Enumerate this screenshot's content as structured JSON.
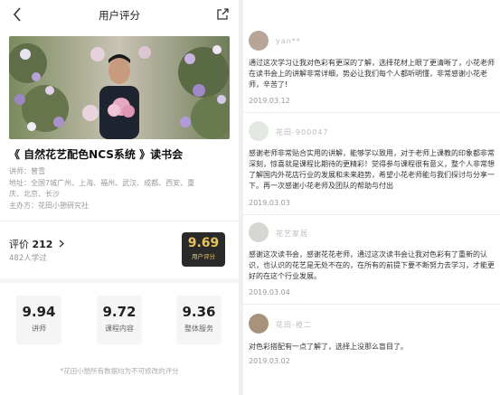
{
  "header": {
    "title": "用户评分"
  },
  "course": {
    "title": "《 自然花艺配色NCS系统 》读书会",
    "lecturer_label": "讲师：",
    "lecturer": "曾雪",
    "address_label": "地址：",
    "address_line1": "全国7城广州、上海、福州、武汉、成都、西安、重",
    "address_line2": "庆、北京、长沙",
    "organizer_label": "主办方：",
    "organizer": "花田小憩研究社"
  },
  "rating": {
    "label": "评价",
    "count": "212",
    "learned": "482人学过",
    "score": "9.69",
    "score_label": "用户评分"
  },
  "sub_scores": [
    {
      "value": "9.94",
      "label": "讲师"
    },
    {
      "value": "9.72",
      "label": "课程内容"
    },
    {
      "value": "9.36",
      "label": "整体服务"
    }
  ],
  "footnote": "*花田小憩所有数据均为不可修改的评分",
  "reviews": [
    {
      "name": "yan**",
      "text": "通过这次学习让我对色彩有更深的了解，选择花材上眼了更清晰了，小花老师在读书会上的讲解非常详细，势必让我们每个人都听明懂，非常感谢小花老师，辛苦了!",
      "date": "2019.03.12"
    },
    {
      "name": "花田-900047",
      "text": "感谢老师非常贴合实用的讲解，能够学以致用，对于老师上课教的印象都非常深刻，惊喜就是课程比期待的更精彩！觉得参与课程很有意义，整个人非常想了解国内外花店行业的发展和未来趋势，希望小花老师能与我们探讨与分享一下。再一次感谢小花老师及团队的帮助与付出",
      "date": "2019.03.03"
    },
    {
      "name": "花艺家居",
      "text": "感谢这次读书会，感谢花花老师，通过这次读书会让我对色彩有了重新的认识，也认识的花艺是无处不在的，在所有的前提下要不断努力去学习，才能更好的在这个行业发展。",
      "date": "2019.03.04"
    },
    {
      "name": "花田-橙二",
      "text": "对色彩搭配有一点了解了，选择上没那么盲目了。",
      "date": "2019.03.02"
    }
  ]
}
